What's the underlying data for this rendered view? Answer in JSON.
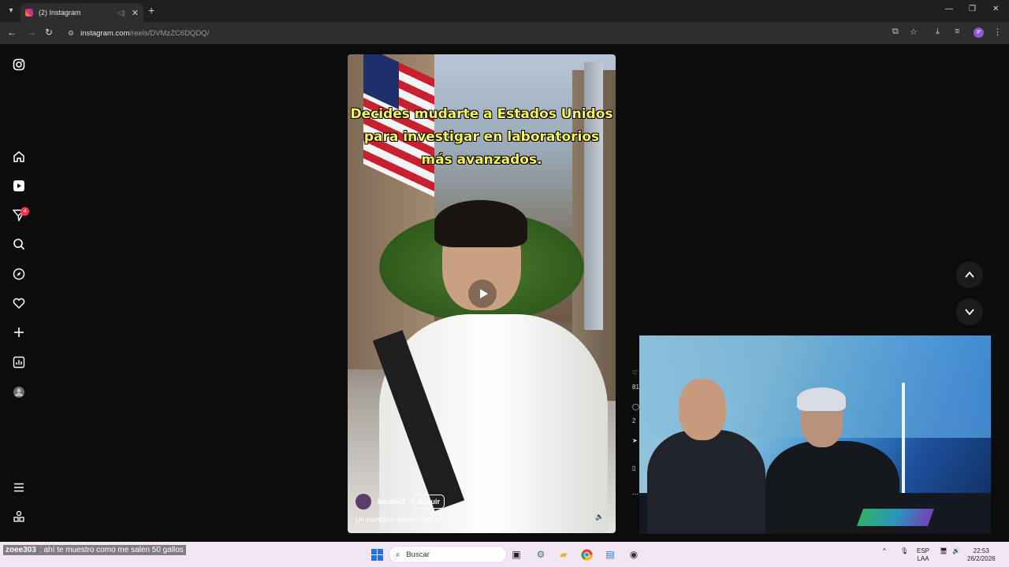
{
  "browser": {
    "tab_title": "(2) Instagram",
    "url_host": "instagram.com",
    "url_path": "/reels/DVMzZC6DQDQ/",
    "profile_initial": "P"
  },
  "sidebar": {
    "notification_count": "4",
    "items": [
      "instagram-logo",
      "home",
      "reels",
      "messages",
      "search",
      "explore",
      "notifications",
      "create",
      "dashboard",
      "profile",
      "more",
      "meta-apps"
    ]
  },
  "reel": {
    "caption_lines": [
      "Decides mudarte a Estados Unidos",
      "para investigar en laboratorios",
      "más avanzados."
    ],
    "author": "locofer3",
    "follow_label": "Seguir",
    "description": "Un científico excepcional...",
    "rail_like_count": "81",
    "rail_comment_count": "2"
  },
  "chat": {
    "user": "zoee303",
    "message": ": ahí te muestro como me salen 50 gallos"
  },
  "taskbar": {
    "search_placeholder": "Buscar",
    "lang_top": "ESP",
    "lang_bottom": "LAA",
    "time": "22:53",
    "date": "26/2/2026"
  },
  "colors": {
    "caption_yellow": "#f7f35a",
    "badge_red": "#ff3040",
    "chat_bg": "#f2e6f2"
  }
}
